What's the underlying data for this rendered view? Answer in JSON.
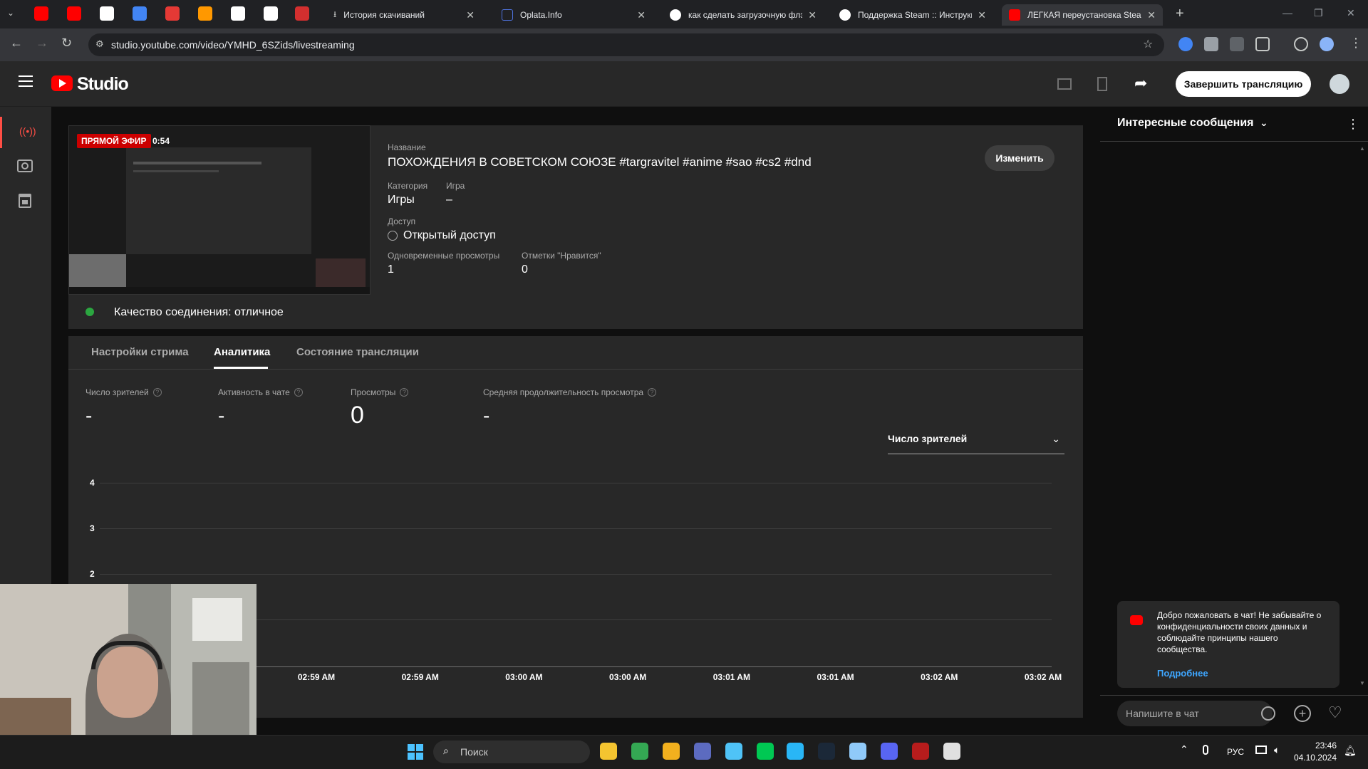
{
  "browser": {
    "pinned_tabs": [
      {
        "icon": "youtube-icon",
        "color": "#ff0000"
      },
      {
        "icon": "youtube-icon",
        "color": "#ff0000"
      },
      {
        "icon": "globe-icon",
        "color": "#ffffff"
      },
      {
        "icon": "app-icon",
        "color": "#4285f4"
      },
      {
        "icon": "dps-icon",
        "color": "#e53935"
      },
      {
        "icon": "fire-icon",
        "color": "#ff9800"
      },
      {
        "icon": "r-icon",
        "color": "#ffffff"
      },
      {
        "icon": "r-icon",
        "color": "#ffffff"
      },
      {
        "icon": "play-icon",
        "color": "#d32f2f"
      }
    ],
    "tabs": [
      {
        "title": "История скачиваний",
        "icon": "download-icon"
      },
      {
        "title": "Oplata.Info",
        "icon": "page-icon"
      },
      {
        "title": "как сделать загрузочную флэ",
        "icon": "google-icon"
      },
      {
        "title": "Поддержка Steam :: Инструкц",
        "icon": "steam-icon"
      },
      {
        "title": "ЛЕГКАЯ переустановка Steam",
        "icon": "youtube-icon"
      }
    ],
    "new_tab": "+",
    "url": "studio.youtube.com/video/YMHD_6SZids/livestreaming"
  },
  "studio": {
    "logo_text": "Studio",
    "end_stream_button": "Завершить трансляцию"
  },
  "stream": {
    "live_badge": "ПРЯМОЙ ЭФИР",
    "duration": "0:54",
    "title_label": "Название",
    "title": "ПОХОЖДЕНИЯ В СОВЕТСКОМ СОЮЗЕ #targravitel #anime #sao #cs2 #dnd",
    "edit_button": "Изменить",
    "category_label": "Категория",
    "category": "Игры",
    "game_label": "Игра",
    "game": "–",
    "access_label": "Доступ",
    "access": "Открытый доступ",
    "concurrent_label": "Одновременные просмотры",
    "concurrent": "1",
    "likes_label": "Отметки \"Нравится\"",
    "likes": "0",
    "quality": "Качество соединения: отличное"
  },
  "tabs": [
    {
      "label": "Настройки стрима"
    },
    {
      "label": "Аналитика"
    },
    {
      "label": "Состояние трансляции"
    }
  ],
  "metrics": [
    {
      "label": "Число зрителей",
      "value": "-"
    },
    {
      "label": "Активность в чате",
      "value": "-"
    },
    {
      "label": "Просмотры",
      "value": "0"
    },
    {
      "label": "Средняя продолжительность просмотра",
      "value": "-"
    }
  ],
  "metric_select": "Число зрителей",
  "chart_data": {
    "type": "line",
    "y_ticks": [
      "4",
      "3",
      "2"
    ],
    "ylim": [
      0,
      4
    ],
    "x_ticks": [
      "02:59 AM",
      "02:59 AM",
      "03:00 AM",
      "03:00 AM",
      "03:01 AM",
      "03:01 AM",
      "03:02 AM",
      "03:02 AM"
    ],
    "series": [],
    "grid": true
  },
  "chat": {
    "header": "Интересные сообщения",
    "welcome": "Добро пожаловать в чат! Не забывайте о конфиденциальности своих данных и соблюдайте принципы нашего сообщества.",
    "more_link": "Подробнее",
    "input_placeholder": "Напишите в чат"
  },
  "taskbar": {
    "search": "Поиск",
    "lang": "РУС",
    "time": "23:46",
    "date": "04.10.2024",
    "apps": [
      {
        "icon": "file-explorer-icon",
        "color": "#f4c430"
      },
      {
        "icon": "chrome-icon",
        "color": "#34a853"
      },
      {
        "icon": "folder-icon",
        "color": "#f2b01e"
      },
      {
        "icon": "store-icon",
        "color": "#5c6bc0"
      },
      {
        "icon": "globe-app-icon",
        "color": "#4fc3f7"
      },
      {
        "icon": "audition-icon",
        "color": "#00c853"
      },
      {
        "icon": "telegram-icon",
        "color": "#29b6f6"
      },
      {
        "icon": "steam-icon",
        "color": "#1b2838"
      },
      {
        "icon": "app-icon",
        "color": "#90caf9"
      },
      {
        "icon": "discord-icon",
        "color": "#5865f2"
      },
      {
        "icon": "obs-app-icon",
        "color": "#b71c1c"
      },
      {
        "icon": "obs-icon",
        "color": "#e0e0e0"
      }
    ]
  }
}
